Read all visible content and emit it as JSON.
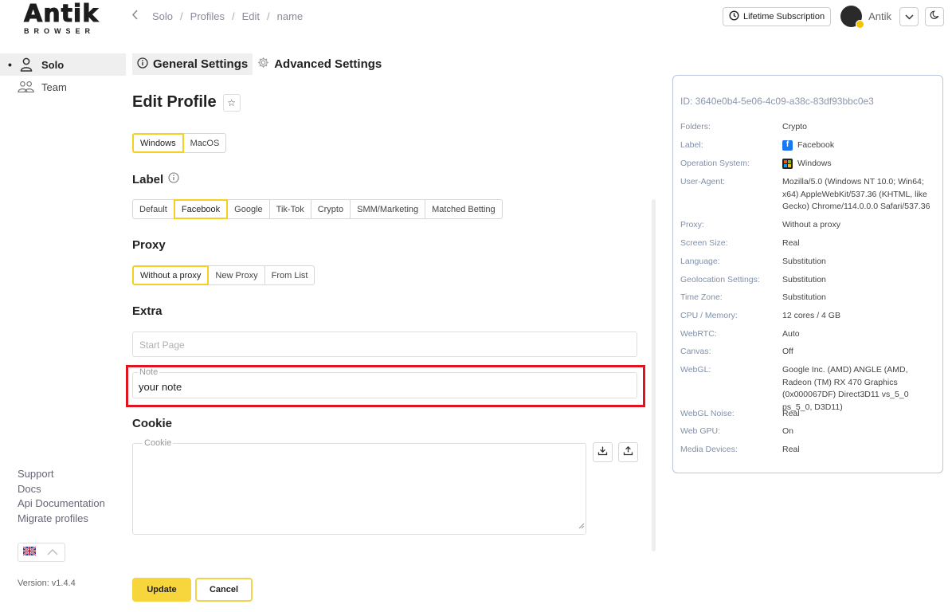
{
  "brand": {
    "name": "Antik",
    "sub": "BROWSER"
  },
  "sidebar": {
    "items": [
      {
        "label": "Solo",
        "active": true
      },
      {
        "label": "Team",
        "active": false
      }
    ],
    "links": [
      "Support",
      "Docs",
      "Api Documentation",
      "Migrate profiles"
    ],
    "version": "Version: v1.4.4"
  },
  "header": {
    "breadcrumb": [
      "Solo",
      "Profiles",
      "Edit",
      "name"
    ],
    "subscription": "Lifetime Subscription",
    "user": "Antik"
  },
  "tabs": [
    "General Settings",
    "Advanced Settings"
  ],
  "form": {
    "title": "Edit Profile",
    "os_options": [
      "Windows",
      "MacOS"
    ],
    "os_selected": "Windows",
    "label_heading": "Label",
    "label_options": [
      "Default",
      "Facebook",
      "Google",
      "Tik-Tok",
      "Crypto",
      "SMM/Marketing",
      "Matched Betting"
    ],
    "label_selected": "Facebook",
    "proxy_heading": "Proxy",
    "proxy_options": [
      "Without a proxy",
      "New Proxy",
      "From List"
    ],
    "proxy_selected": "Without a proxy",
    "extra_heading": "Extra",
    "start_page_placeholder": "Start Page",
    "note_label": "Note",
    "note_value": "your note",
    "cookie_heading": "Cookie",
    "cookie_label": "Cookie",
    "update_label": "Update",
    "cancel_label": "Cancel"
  },
  "info": {
    "id": "ID: 3640e0b4-5e06-4c09-a38c-83df93bbc0e3",
    "rows": [
      {
        "key": "Folders:",
        "value": "Crypto"
      },
      {
        "key": "Label:",
        "value": "Facebook",
        "icon": "facebook-icon"
      },
      {
        "key": "Operation System:",
        "value": "Windows",
        "icon": "windows-icon"
      },
      {
        "key": "User-Agent:",
        "value": "Mozilla/5.0 (Windows NT 10.0; Win64; x64) AppleWebKit/537.36 (KHTML, like Gecko) Chrome/114.0.0.0 Safari/537.36"
      },
      {
        "key": "Proxy:",
        "value": "Without a proxy"
      },
      {
        "key": "Screen Size:",
        "value": "Real"
      },
      {
        "key": "Language:",
        "value": "Substitution"
      },
      {
        "key": "Geolocation Settings:",
        "value": "Substitution"
      },
      {
        "key": "Time Zone:",
        "value": "Substitution"
      },
      {
        "key": "CPU / Memory:",
        "value": "12 cores / 4 GB"
      },
      {
        "key": "WebRTC:",
        "value": "Auto"
      },
      {
        "key": "Canvas:",
        "value": "Off"
      },
      {
        "key": "WebGL:",
        "value": "Google Inc. (AMD) ANGLE (AMD, Radeon (TM) RX 470 Graphics (0x000067DF) Direct3D11 vs_5_0 ps_5_0, D3D11)"
      },
      {
        "key": "WebGL Noise:",
        "value": "Real"
      },
      {
        "key": "Web GPU:",
        "value": "On"
      },
      {
        "key": "Media Devices:",
        "value": "Real"
      }
    ]
  },
  "colors": {
    "accent": "#f7d53c",
    "highlight": "#e0141e",
    "panel_border": "#b9c6dc"
  }
}
